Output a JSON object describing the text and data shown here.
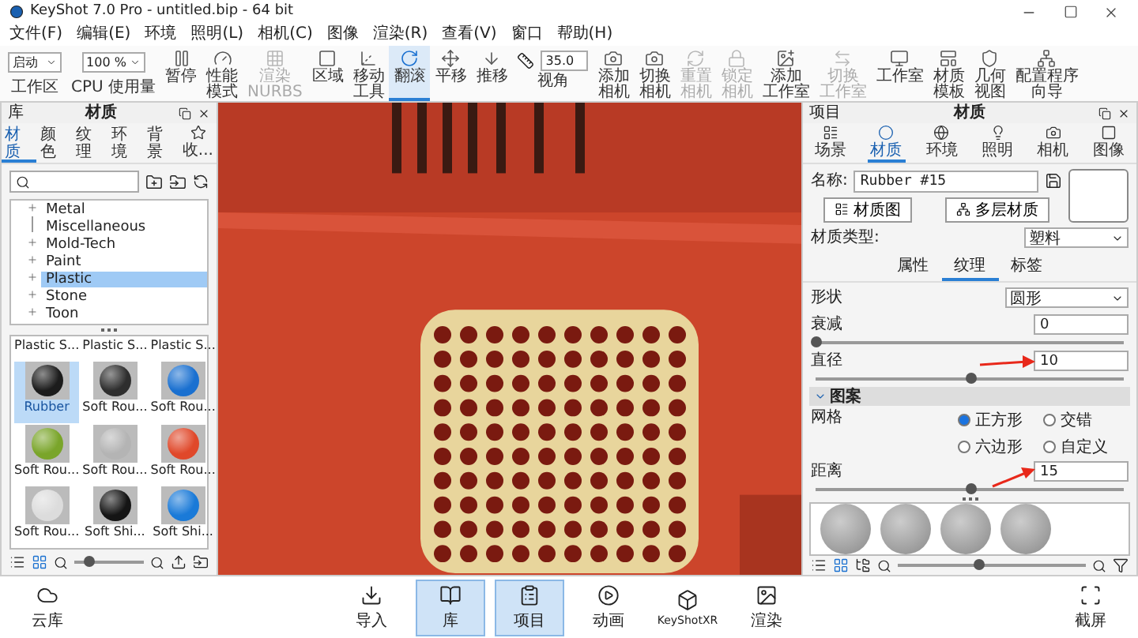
{
  "window": {
    "title": "KeyShot 7.0 Pro  - untitled.bip  - 64 bit"
  },
  "menu": [
    "文件(F)",
    "编辑(E)",
    "环境",
    "照明(L)",
    "相机(C)",
    "图像",
    "渲染(R)",
    "查看(V)",
    "窗口",
    "帮助(H)"
  ],
  "toolbar": [
    {
      "kind": "dropdown",
      "value": "启动",
      "label": "工作区"
    },
    {
      "kind": "dropdown",
      "value": "100 %",
      "label": "CPU 使用量"
    },
    {
      "kind": "button",
      "label": [
        "暂停"
      ],
      "selected": false,
      "disabled": false
    },
    {
      "kind": "button",
      "label": [
        "性能",
        "模式"
      ],
      "selected": false,
      "disabled": false
    },
    {
      "kind": "button",
      "label": [
        "渲染",
        "NURBS"
      ],
      "selected": false,
      "disabled": true
    },
    {
      "kind": "button",
      "label": [
        "区域"
      ],
      "selected": false,
      "disabled": false
    },
    {
      "kind": "button",
      "label": [
        "移动",
        "工具"
      ],
      "selected": false,
      "disabled": false
    },
    {
      "kind": "button",
      "label": [
        "翻滚"
      ],
      "selected": true,
      "disabled": false
    },
    {
      "kind": "button",
      "label": [
        "平移"
      ],
      "selected": false,
      "disabled": false
    },
    {
      "kind": "button",
      "label": [
        "推移"
      ],
      "selected": false,
      "disabled": false
    },
    {
      "kind": "field",
      "value": "35.0",
      "label": "视角"
    },
    {
      "kind": "button",
      "label": [
        "添加",
        "相机"
      ],
      "selected": false,
      "disabled": false
    },
    {
      "kind": "button",
      "label": [
        "切换",
        "相机"
      ],
      "selected": false,
      "disabled": false
    },
    {
      "kind": "button",
      "label": [
        "重置",
        "相机"
      ],
      "selected": false,
      "disabled": true
    },
    {
      "kind": "button",
      "label": [
        "锁定",
        "相机"
      ],
      "selected": false,
      "disabled": true
    },
    {
      "kind": "button",
      "label": [
        "添加",
        "工作室"
      ],
      "selected": false,
      "disabled": false
    },
    {
      "kind": "button",
      "label": [
        "切换",
        "工作室"
      ],
      "selected": false,
      "disabled": true
    },
    {
      "kind": "button",
      "label": [
        "工作室"
      ],
      "selected": false,
      "disabled": false
    },
    {
      "kind": "button",
      "label": [
        "材质",
        "模板"
      ],
      "selected": false,
      "disabled": false
    },
    {
      "kind": "button",
      "label": [
        "几何",
        "视图"
      ],
      "selected": false,
      "disabled": false
    },
    {
      "kind": "button",
      "label": [
        "配置程序",
        "向导"
      ],
      "selected": false,
      "disabled": false
    }
  ],
  "library_panel": {
    "header": "库",
    "title": "材质",
    "tabs": [
      {
        "label": "材质",
        "selected": true
      },
      {
        "label": "颜色",
        "selected": false
      },
      {
        "label": "纹理",
        "selected": false
      },
      {
        "label": "环境",
        "selected": false
      },
      {
        "label": "背景",
        "selected": false
      },
      {
        "label": "收...",
        "selected": false
      }
    ],
    "tree": [
      {
        "label": "Metal",
        "expandable": true,
        "selected": false
      },
      {
        "label": "Miscellaneous",
        "expandable": false,
        "selected": false
      },
      {
        "label": "Mold-Tech",
        "expandable": true,
        "selected": false
      },
      {
        "label": "Paint",
        "expandable": true,
        "selected": false
      },
      {
        "label": "Plastic",
        "expandable": true,
        "selected": true
      },
      {
        "label": "Stone",
        "expandable": true,
        "selected": false
      },
      {
        "label": "Toon",
        "expandable": true,
        "selected": false
      }
    ],
    "cut_items": [
      "Plastic S...",
      "Plastic S...",
      "Plastic S..."
    ],
    "thumbnails": [
      {
        "label": "Rubber",
        "color": "#1c1c1c",
        "selected": true
      },
      {
        "label": "Soft Rou...",
        "color": "#2e2e2e",
        "selected": false
      },
      {
        "label": "Soft Rou...",
        "color": "#1a70d0",
        "selected": false
      },
      {
        "label": "Soft Rou...",
        "color": "#7aa52a",
        "selected": false
      },
      {
        "label": "Soft Rou...",
        "color": "#b4b4b4",
        "selected": false
      },
      {
        "label": "Soft Rou...",
        "color": "#e0482a",
        "selected": false
      },
      {
        "label": "Soft Rou...",
        "color": "#dcdcdc",
        "selected": false
      },
      {
        "label": "Soft Shi...",
        "color": "#151515",
        "selected": false
      },
      {
        "label": "Soft Shi...",
        "color": "#1a7ad8",
        "selected": false
      }
    ],
    "zoom_slider": {
      "level": 0.2
    }
  },
  "project_panel": {
    "header": "项目",
    "title": "材质",
    "tabs": [
      {
        "label": "场景",
        "selected": false
      },
      {
        "label": "材质",
        "selected": true
      },
      {
        "label": "环境",
        "selected": false
      },
      {
        "label": "照明",
        "selected": false
      },
      {
        "label": "相机",
        "selected": false
      },
      {
        "label": "图像",
        "selected": false
      }
    ],
    "name_label": "名称:",
    "name_value": "Rubber #15",
    "buttons": [
      "材质图",
      "多层材质"
    ],
    "type_label": "材质类型:",
    "type_value": "塑料",
    "subtabs": [
      {
        "label": "属性",
        "selected": false
      },
      {
        "label": "纹理",
        "selected": true
      },
      {
        "label": "标签",
        "selected": false
      }
    ],
    "params": [
      {
        "kind": "dropdown",
        "label": "形状",
        "value": "圆形"
      },
      {
        "kind": "slider",
        "label": "衰减",
        "value": "0",
        "level": 0
      },
      {
        "kind": "slider",
        "label": "直径",
        "value": "10",
        "level": 0.5
      }
    ],
    "section": {
      "title": "图案",
      "expanded": true
    },
    "grid_label": "网格",
    "grid_options": [
      {
        "label": "正方形",
        "selected": true
      },
      {
        "label": "交错",
        "selected": false
      },
      {
        "label": "六边形",
        "selected": false
      },
      {
        "label": "自定义",
        "selected": false
      }
    ],
    "distance": {
      "label": "距离",
      "value": "15",
      "level": 0.5
    },
    "zoom_slider": {
      "level": 0.43
    }
  },
  "dock": {
    "cloud": "云库",
    "buttons": [
      {
        "label": "导入",
        "selected": false
      },
      {
        "label": "库",
        "selected": true
      },
      {
        "label": "项目",
        "selected": true
      },
      {
        "label": "动画",
        "selected": false
      },
      {
        "label": "KeyShotXR",
        "selected": false
      },
      {
        "label": "渲染",
        "selected": false
      }
    ],
    "screenshot": "截屏"
  }
}
